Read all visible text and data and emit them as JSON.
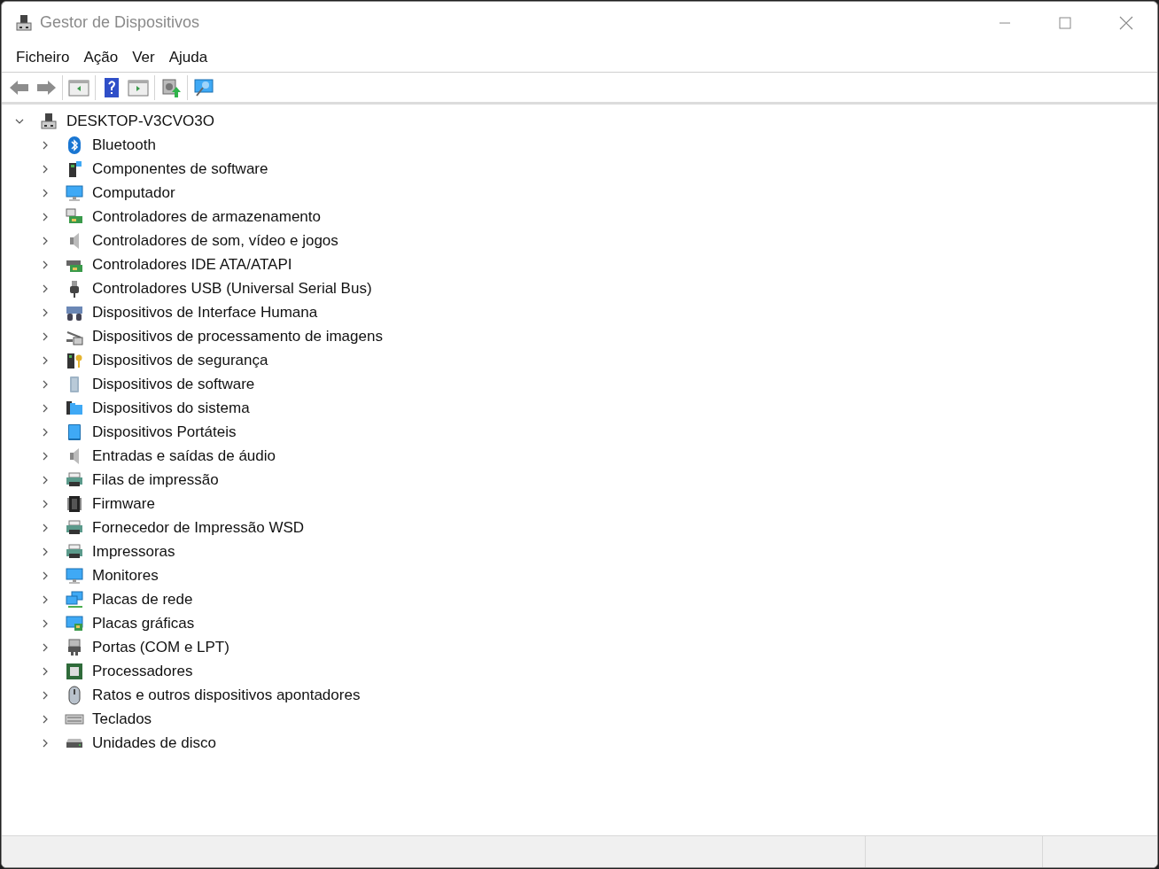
{
  "window": {
    "title": "Gestor de Dispositivos"
  },
  "menu": [
    "Ficheiro",
    "Ação",
    "Ver",
    "Ajuda"
  ],
  "tree": {
    "label": "DESKTOP-V3CVO3O",
    "expanded": true,
    "children": [
      {
        "label": "Bluetooth",
        "expanded": false
      },
      {
        "label": "Componentes de software",
        "expanded": false
      },
      {
        "label": "Computador",
        "expanded": false
      },
      {
        "label": "Controladores de armazenamento",
        "expanded": false
      },
      {
        "label": "Controladores de som, vídeo e jogos",
        "expanded": false
      },
      {
        "label": "Controladores IDE ATA/ATAPI",
        "expanded": false
      },
      {
        "label": "Controladores USB (Universal Serial Bus)",
        "expanded": false
      },
      {
        "label": "Dispositivos de Interface Humana",
        "expanded": false
      },
      {
        "label": "Dispositivos de processamento de imagens",
        "expanded": false
      },
      {
        "label": "Dispositivos de segurança",
        "expanded": false
      },
      {
        "label": "Dispositivos de software",
        "expanded": false
      },
      {
        "label": "Dispositivos do sistema",
        "expanded": false
      },
      {
        "label": "Dispositivos Portáteis",
        "expanded": false
      },
      {
        "label": "Entradas e saídas de áudio",
        "expanded": false
      },
      {
        "label": "Filas de impressão",
        "expanded": false
      },
      {
        "label": "Firmware",
        "expanded": false
      },
      {
        "label": "Fornecedor de Impressão WSD",
        "expanded": false
      },
      {
        "label": "Impressoras",
        "expanded": false
      },
      {
        "label": "Monitores",
        "expanded": false
      },
      {
        "label": "Placas de rede",
        "expanded": false
      },
      {
        "label": "Placas gráficas",
        "expanded": false
      },
      {
        "label": "Portas (COM e LPT)",
        "expanded": false
      },
      {
        "label": "Processadores",
        "expanded": false
      },
      {
        "label": "Ratos e outros dispositivos apontadores",
        "expanded": false
      },
      {
        "label": "Teclados",
        "expanded": false
      },
      {
        "label": "Unidades de disco",
        "expanded": false
      }
    ]
  }
}
